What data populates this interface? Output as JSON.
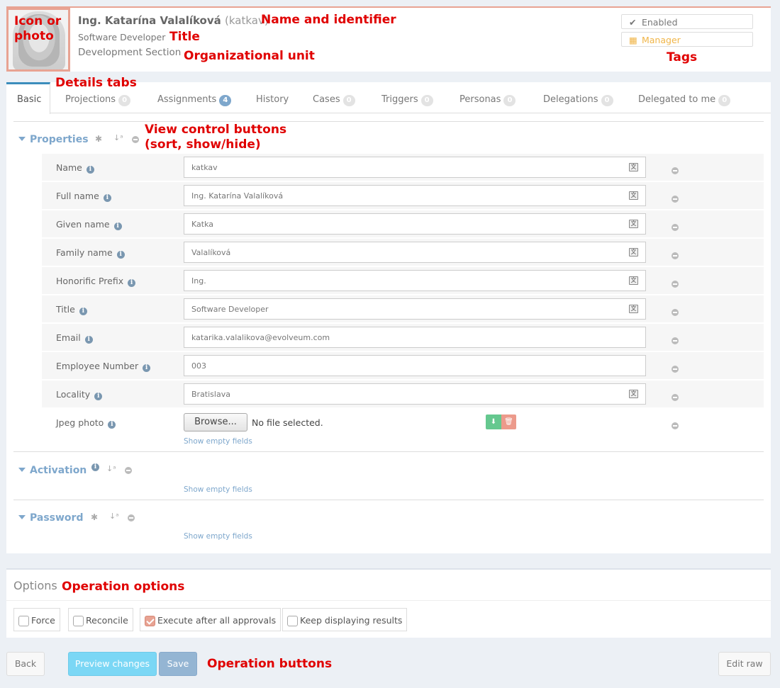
{
  "header": {
    "name": "Ing. Katarína Valalíková",
    "identifier": "(katkav)",
    "title": "Software Developer",
    "org_unit": "Development Section",
    "tags": [
      {
        "label": "Enabled",
        "icon": "check-icon",
        "color": "#777777"
      },
      {
        "label": "Manager",
        "icon": "building-icon",
        "color": "#f0b548"
      }
    ]
  },
  "tabs": [
    {
      "label": "Basic",
      "count": null
    },
    {
      "label": "Projections",
      "count": "0"
    },
    {
      "label": "Assignments",
      "count": "4"
    },
    {
      "label": "History",
      "count": null
    },
    {
      "label": "Cases",
      "count": "0"
    },
    {
      "label": "Triggers",
      "count": "0"
    },
    {
      "label": "Personas",
      "count": "0"
    },
    {
      "label": "Delegations",
      "count": "0"
    },
    {
      "label": "Delegated to me",
      "count": "0"
    }
  ],
  "properties": {
    "title": "Properties",
    "fields": [
      {
        "label": "Name",
        "value": "katkav"
      },
      {
        "label": "Full name",
        "value": "Ing. Katarína Valalíková"
      },
      {
        "label": "Given name",
        "value": "Katka"
      },
      {
        "label": "Family name",
        "value": "Valalíková"
      },
      {
        "label": "Honorific Prefix",
        "value": "Ing."
      },
      {
        "label": "Title",
        "value": "Software Developer"
      },
      {
        "label": "Email",
        "value": "katarika.valalikova@evolveum.com"
      },
      {
        "label": "Employee Number",
        "value": "003"
      },
      {
        "label": "Locality",
        "value": "Bratislava"
      }
    ],
    "photo": {
      "label": "Jpeg photo",
      "browse_label": "Browse...",
      "no_file": "No file selected."
    },
    "show_empty": "Show empty fields"
  },
  "activation": {
    "title": "Activation",
    "show_empty": "Show empty fields"
  },
  "password": {
    "title": "Password",
    "show_empty": "Show empty fields"
  },
  "options": {
    "title": "Options",
    "checkboxes": [
      {
        "label": "Force",
        "checked": false
      },
      {
        "label": "Reconcile",
        "checked": false
      },
      {
        "label": "Execute after all approvals",
        "checked": true
      },
      {
        "label": "Keep displaying results",
        "checked": false
      }
    ]
  },
  "buttons": {
    "back": "Back",
    "preview": "Preview changes",
    "save": "Save",
    "edit_raw": "Edit raw"
  },
  "annotations": {
    "icon_photo": "Icon or photo",
    "name_identifier": "Name and identifier",
    "title": "Title",
    "org_unit": "Organizational unit",
    "tags": "Tags",
    "details_tabs": "Details tabs",
    "view_control_line1": "View control buttons",
    "view_control_line2": "(sort, show/hide)",
    "operation_options": "Operation options",
    "operation_buttons": "Operation buttons"
  }
}
